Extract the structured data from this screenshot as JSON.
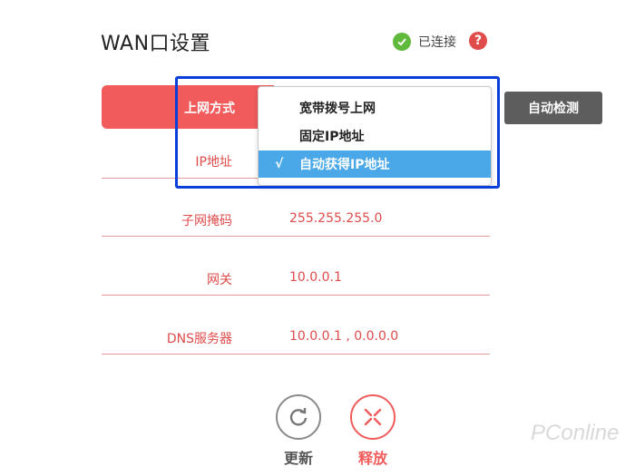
{
  "header": {
    "title": "WAN口设置",
    "status": "已连接",
    "help": "?"
  },
  "form": {
    "mode_label": "上网方式",
    "dropdown": {
      "options": [
        "宽带拨号上网",
        "固定IP地址",
        "自动获得IP地址"
      ],
      "selected_index": 2,
      "tick": "√"
    },
    "detect_button": "自动检测",
    "rows": [
      {
        "label": "IP地址",
        "value": ""
      },
      {
        "label": "子网掩码",
        "value": "255.255.255.0"
      },
      {
        "label": "网关",
        "value": "10.0.0.1"
      },
      {
        "label": "DNS服务器",
        "value": "10.0.0.1 , 0.0.0.0"
      }
    ]
  },
  "actions": {
    "refresh_label": "更新",
    "release_label": "释放"
  },
  "watermark": "PConline",
  "colors": {
    "accent": "#f15b5b",
    "selected": "#4aa8e8",
    "highlight": "#0a3ed8",
    "ok": "#5fba3c"
  }
}
